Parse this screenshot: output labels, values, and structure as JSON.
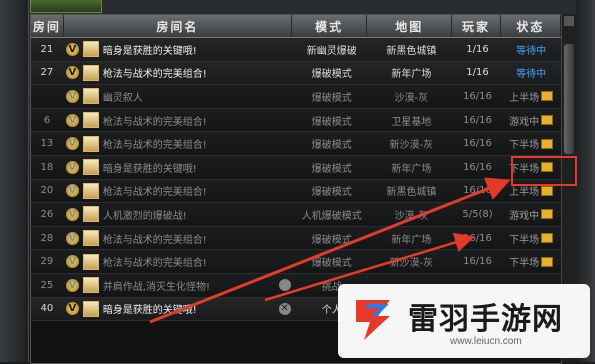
{
  "header": {
    "num": "房间",
    "name": "房间名",
    "mode": "模式",
    "map": "地图",
    "players": "玩家",
    "status": "状态"
  },
  "rows": [
    {
      "num": "21",
      "name": "暗身是获胜的关键哦!",
      "mode": "新幽灵爆破",
      "map": "新黑色城镇",
      "players": "1/16",
      "status": "等待中",
      "dim": false
    },
    {
      "num": "27",
      "name": "枪法与战术的完美组合!",
      "mode": "爆破模式",
      "map": "新年广场",
      "players": "1/16",
      "status": "等待中",
      "dim": false
    },
    {
      "num": "",
      "name": "幽灵叙人",
      "mode": "爆破模式",
      "map": "沙漠-灰",
      "players": "16/16",
      "status": "上半场",
      "dim": true
    },
    {
      "num": "6",
      "name": "枪法与战术的完美组合!",
      "mode": "爆破模式",
      "map": "卫星基地",
      "players": "16/16",
      "status": "游戏中",
      "dim": true
    },
    {
      "num": "13",
      "name": "枪法与战术的完美组合!",
      "mode": "爆破模式",
      "map": "新沙漠-灰",
      "players": "16/16",
      "status": "下半场",
      "dim": true
    },
    {
      "num": "18",
      "name": "暗身是获胜的关键哦!",
      "mode": "爆破模式",
      "map": "新年广场",
      "players": "16/16",
      "status": "下半场",
      "dim": true
    },
    {
      "num": "20",
      "name": "枪法与战术的完美组合!",
      "mode": "爆破模式",
      "map": "新黑色城镇",
      "players": "16/16",
      "status": "上半场",
      "dim": true
    },
    {
      "num": "26",
      "name": "人机激烈的爆破战!",
      "mode": "人机爆破模式",
      "map": "沙漠-灰",
      "players": "5/5(8)",
      "status": "游戏中",
      "dim": true
    },
    {
      "num": "28",
      "name": "枪法与战术的完美组合!",
      "mode": "爆破模式",
      "map": "新年广场",
      "players": "16/16",
      "status": "下半场",
      "dim": true
    },
    {
      "num": "29",
      "name": "枪法与战术的完美组合!",
      "mode": "爆破模式",
      "map": "新沙漠-灰",
      "players": "16/16",
      "status": "下半场",
      "dim": true
    },
    {
      "num": "25",
      "name": "并肩作战,消灭生化怪物!",
      "mode": "挑战",
      "map": "",
      "players": "",
      "status": "",
      "dim": true
    },
    {
      "num": "40",
      "name": "暗身是获胜的关键哦!",
      "mode": "个人",
      "map": "",
      "players": "",
      "status": "",
      "dim": false
    }
  ],
  "watermark": {
    "title": "雷羽手游网",
    "url": "www.leiucn.com"
  },
  "colors": {
    "accent_red": "#e53a2a",
    "status_wait": "#3fa3ff",
    "watermark_blue": "#2a7de1"
  }
}
